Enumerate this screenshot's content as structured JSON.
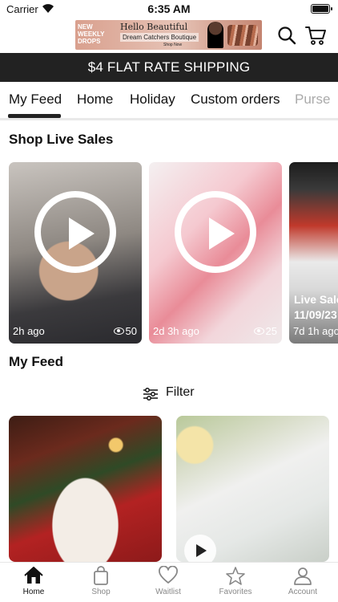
{
  "status_bar": {
    "carrier": "Carrier",
    "time": "6:35 AM"
  },
  "banner": {
    "left_text": "NEW WEEKLY DROPS",
    "title": "Hello Beautiful",
    "subtitle": "Dream Catchers Boutique",
    "cta": "Shop Now"
  },
  "shipping_bar": "$4 FLAT RATE SHIPPING",
  "tabs": [
    "My Feed",
    "Home",
    "Holiday",
    "Custom orders",
    "Purse"
  ],
  "active_tab": "My Feed",
  "sections": {
    "live_sales": "Shop Live Sales",
    "my_feed": "My Feed"
  },
  "live_sales": [
    {
      "time_ago": "2h ago",
      "views": "50"
    },
    {
      "time_ago": "2d 3h ago",
      "views": "25"
    },
    {
      "time_ago": "7d 1h ago",
      "live_label_1": "Live Sale",
      "live_label_2": "11/09/23"
    }
  ],
  "filter": {
    "label": "Filter"
  },
  "bottom_nav": [
    {
      "label": "Home",
      "icon": "home-icon",
      "active": true
    },
    {
      "label": "Shop",
      "icon": "shopping-bag-icon",
      "active": false
    },
    {
      "label": "Waitlist",
      "icon": "heart-icon",
      "active": false
    },
    {
      "label": "Favorites",
      "icon": "star-icon",
      "active": false
    },
    {
      "label": "Account",
      "icon": "user-icon",
      "active": false
    }
  ],
  "colors": {
    "shipping_bar_bg": "#222222",
    "accent": "#111111",
    "muted_text": "#888888"
  }
}
